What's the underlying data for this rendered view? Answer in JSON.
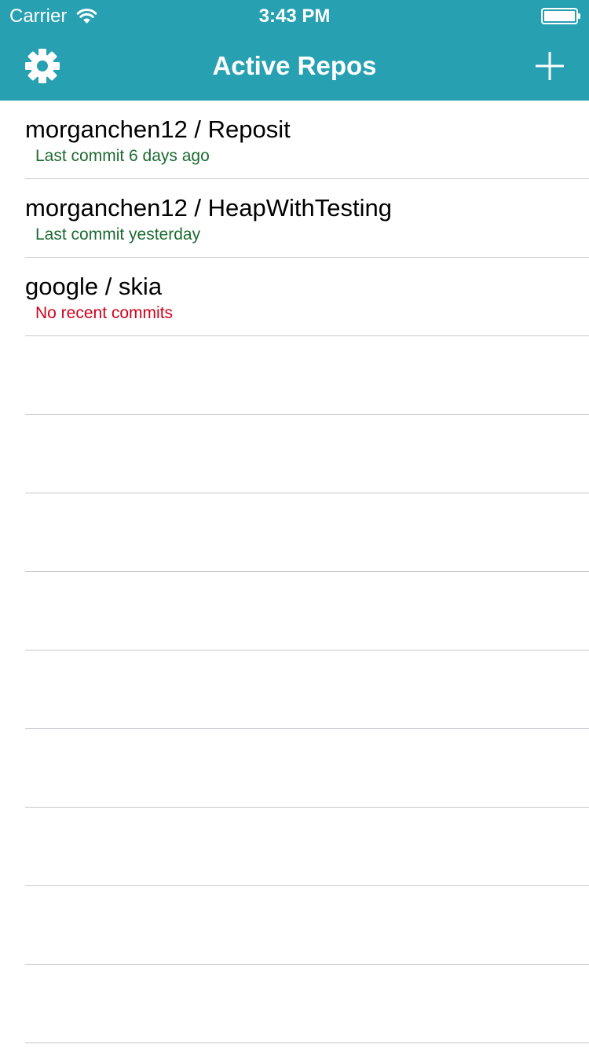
{
  "status_bar": {
    "carrier": "Carrier",
    "time": "3:43 PM",
    "wifi_icon": "wifi-icon",
    "battery_icon": "battery-icon"
  },
  "nav": {
    "title": "Active Repos",
    "settings_icon": "gear-icon",
    "add_icon": "plus-icon"
  },
  "colors": {
    "header": "#27a0b1",
    "active_status": "#1d6b32",
    "inactive_status": "#d0021b",
    "separator": "#c9c9ce"
  },
  "repos": [
    {
      "name": "morganchen12 / Reposit",
      "status": "Last commit 6 days ago"
    },
    {
      "name": "morganchen12 / HeapWithTesting",
      "status": "Last commit yesterday"
    },
    {
      "name": "google / skia",
      "status": "No recent commits"
    }
  ],
  "empty_rows": 9
}
